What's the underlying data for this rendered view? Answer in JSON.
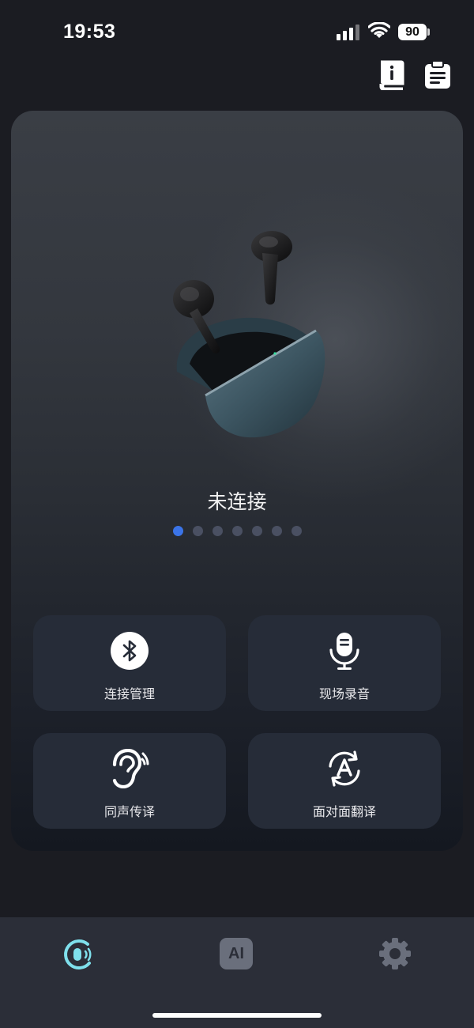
{
  "status_bar": {
    "time": "19:53",
    "battery": "90"
  },
  "device": {
    "connection_status": "未连接",
    "carousel_pages": 7,
    "active_page": 1
  },
  "features": [
    {
      "label": "连接管理",
      "icon": "bluetooth-icon"
    },
    {
      "label": "现场录音",
      "icon": "microphone-icon"
    },
    {
      "label": "同声传译",
      "icon": "ear-icon"
    },
    {
      "label": "面对面翻译",
      "icon": "translate-icon"
    }
  ],
  "tabs": [
    {
      "name": "headset",
      "icon": "headset-voice-icon",
      "active": true
    },
    {
      "name": "ai",
      "label": "AI",
      "icon": "ai-icon",
      "active": false
    },
    {
      "name": "settings",
      "icon": "gear-icon",
      "active": false
    }
  ],
  "colors": {
    "accent": "#3b74e8",
    "active_tab": "#7fe0ec",
    "card": "#262c38",
    "background": "#1b1c22"
  }
}
